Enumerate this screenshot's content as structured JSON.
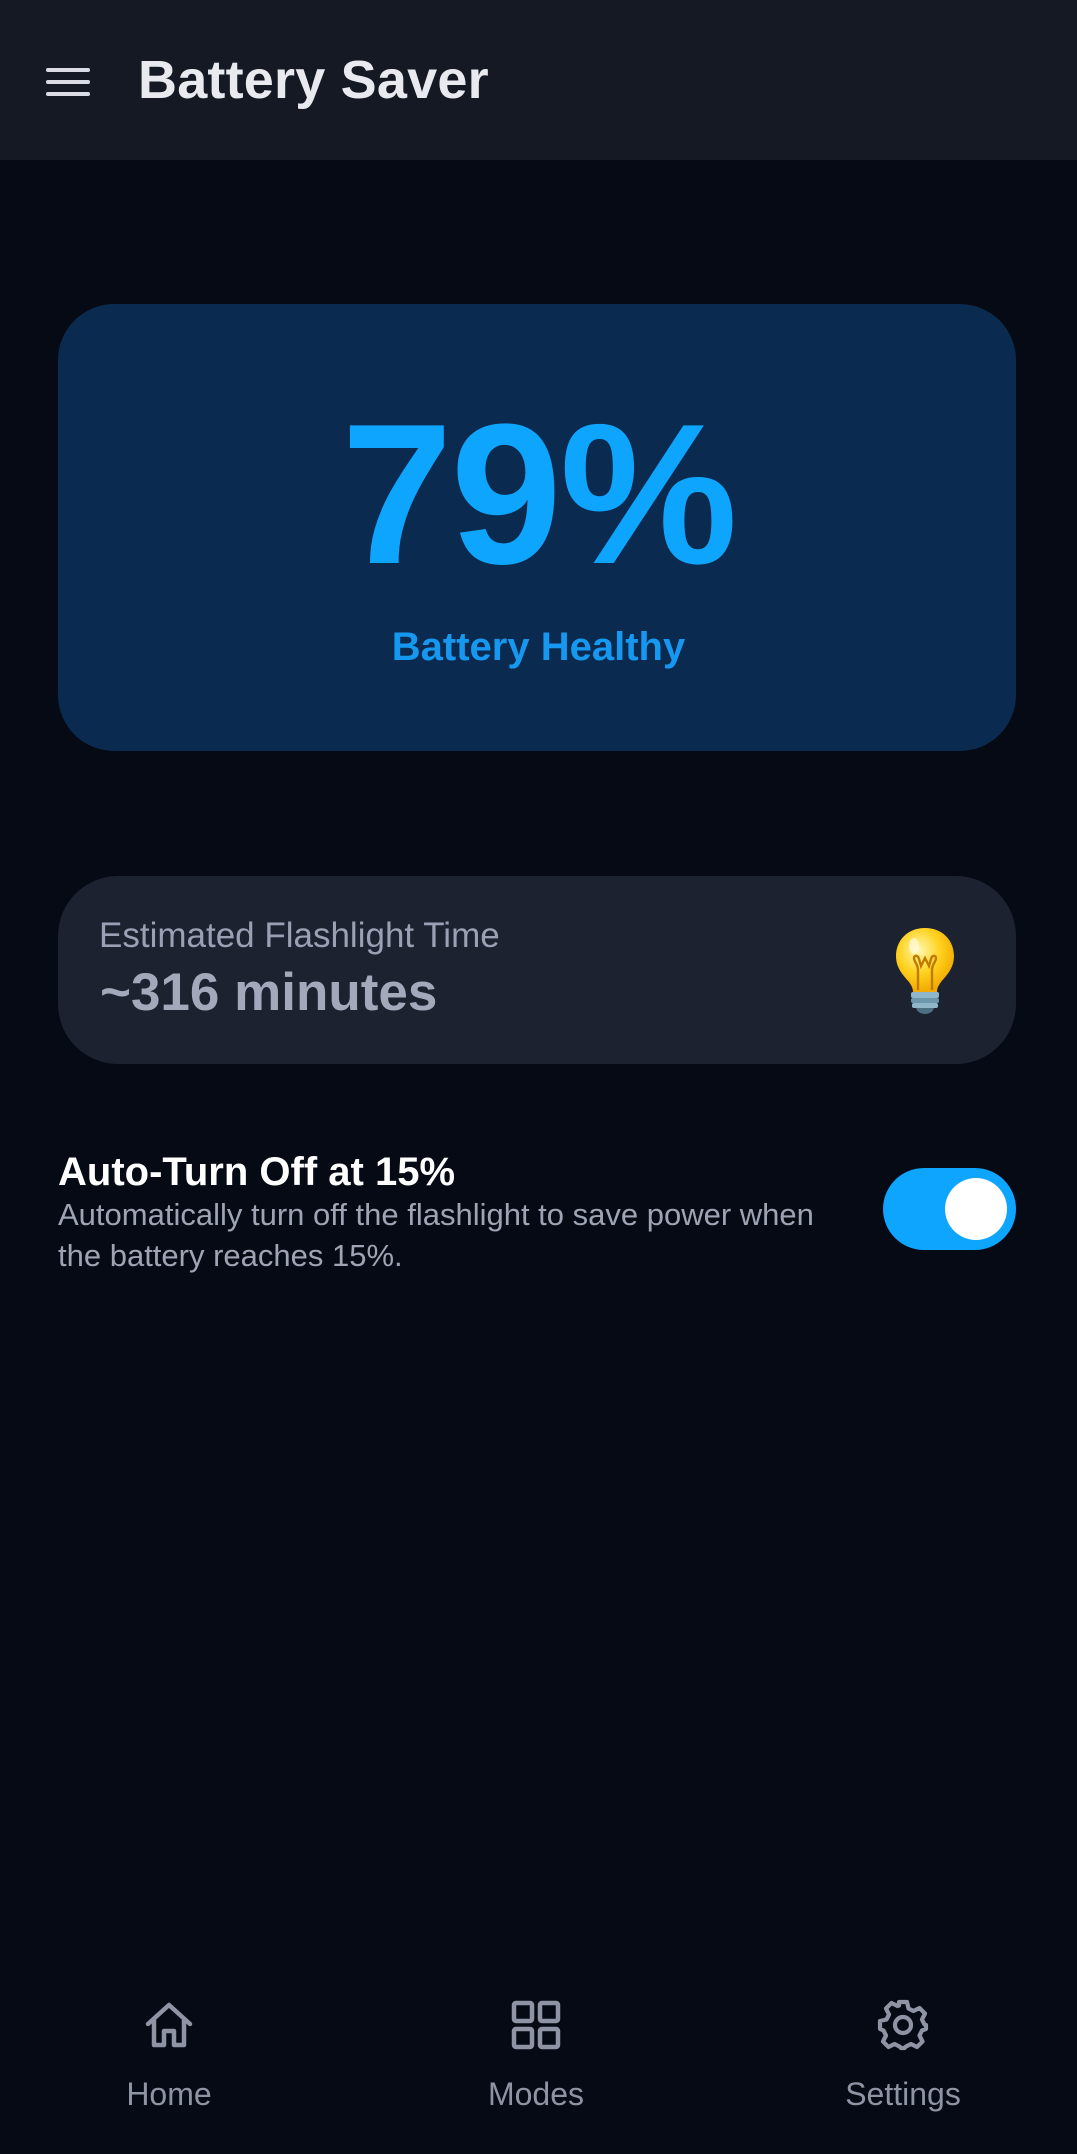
{
  "app_bar": {
    "title": "Battery Saver",
    "menu_icon": "hamburger-menu-icon"
  },
  "battery": {
    "percent_text": "79%",
    "percent_value": 79,
    "status": "Battery Healthy",
    "accent_color": "#0ea5ff"
  },
  "flashlight": {
    "label": "Estimated Flashlight Time",
    "value": "~316 minutes",
    "icon": "lightbulb-icon"
  },
  "auto_off": {
    "title": "Auto-Turn Off at 15%",
    "description": "Automatically turn off the flashlight to save power when the battery reaches 15%.",
    "enabled": true
  },
  "bottom_nav": {
    "items": [
      {
        "label": "Home",
        "icon": "home-icon"
      },
      {
        "label": "Modes",
        "icon": "grid-icon"
      },
      {
        "label": "Settings",
        "icon": "gear-icon"
      }
    ]
  }
}
